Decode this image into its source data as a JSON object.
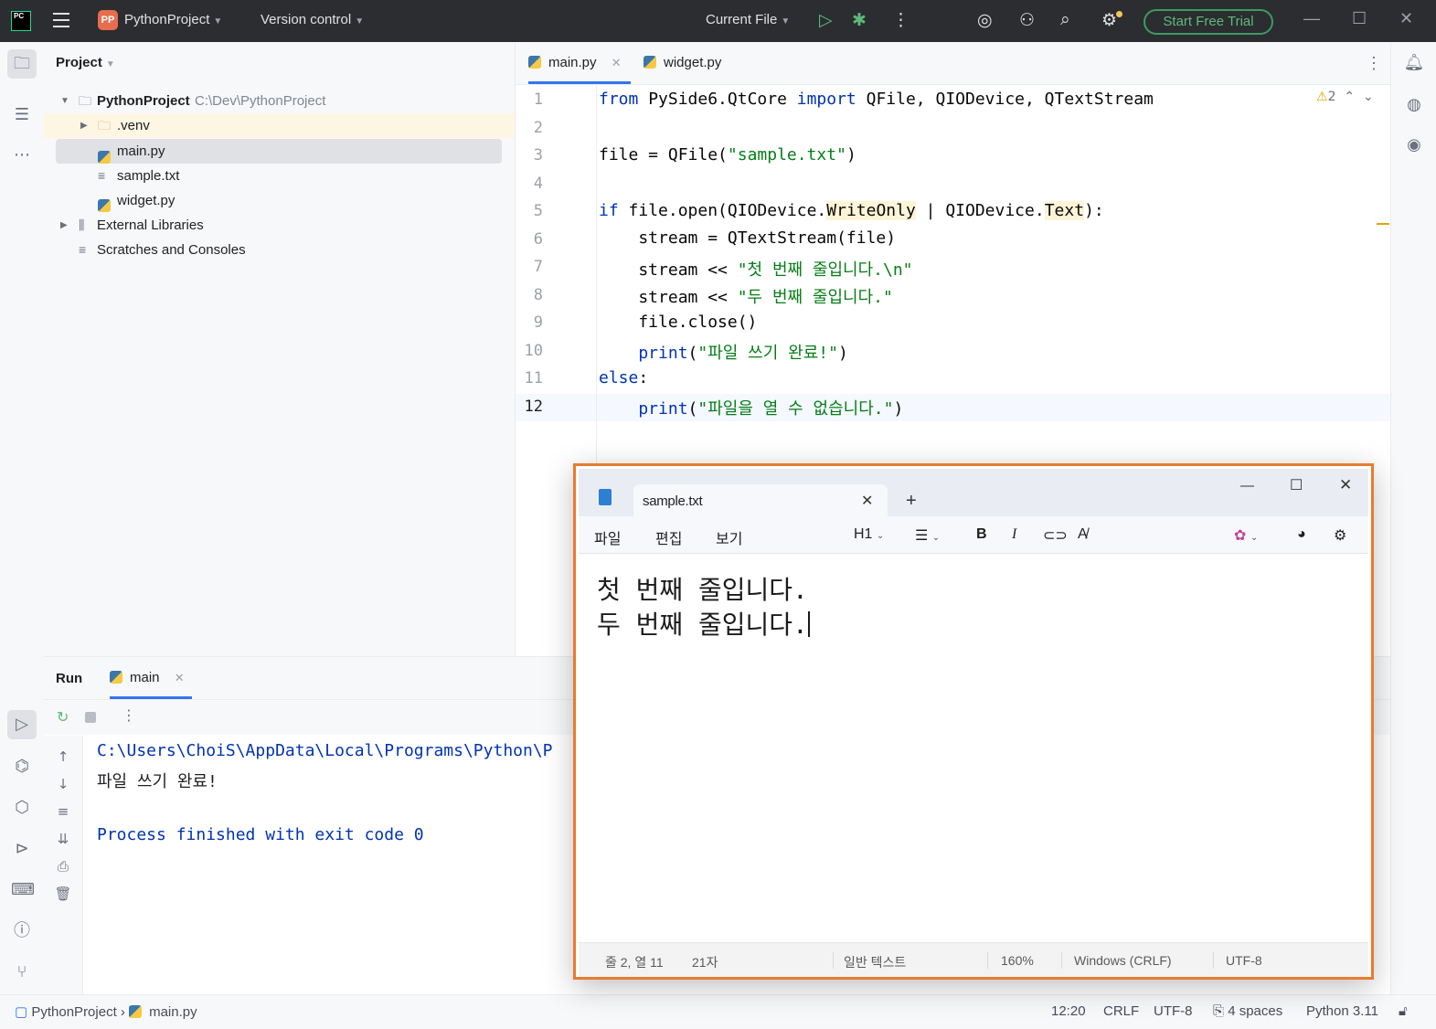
{
  "titlebar": {
    "project_badge": "PP",
    "project_name": "PythonProject",
    "vcs": "Version control",
    "run_config": "Current File",
    "trial_button": "Start Free Trial"
  },
  "project_panel": {
    "header": "Project",
    "root_name": "PythonProject",
    "root_path": "C:\\Dev\\PythonProject",
    "items": [
      {
        "label": ".venv"
      },
      {
        "label": "main.py"
      },
      {
        "label": "sample.txt"
      },
      {
        "label": "widget.py"
      },
      {
        "label": "External Libraries"
      },
      {
        "label": "Scratches and Consoles"
      }
    ]
  },
  "editor": {
    "tabs": [
      {
        "label": "main.py",
        "active": true
      },
      {
        "label": "widget.py",
        "active": false
      }
    ],
    "warning_count": "2",
    "line_numbers": [
      "1",
      "2",
      "3",
      "4",
      "5",
      "6",
      "7",
      "8",
      "9",
      "10",
      "11",
      "12"
    ],
    "lines": {
      "l1_kw1": "from",
      "l1_mod": " PySide6.QtCore ",
      "l1_kw2": "import",
      "l1_rest": " QFile, QIODevice, QTextStream",
      "l3_a": "file = QFile(",
      "l3_str": "\"sample.txt\"",
      "l3_b": ")",
      "l5_kw": "if",
      "l5_a": " file.open(QIODevice.",
      "l5_wo": "WriteOnly",
      "l5_b": " | QIODevice.",
      "l5_text": "Text",
      "l5_c": "):",
      "l6": "    stream = QTextStream(file)",
      "l7_a": "    stream << ",
      "l7_str": "\"첫 번째 줄입니다.\\n\"",
      "l8_a": "    stream << ",
      "l8_str": "\"두 번째 줄입니다.\"",
      "l9": "    file.close()",
      "l10_fn": "    print",
      "l10_a": "(",
      "l10_str": "\"파일 쓰기 완료!\"",
      "l10_b": ")",
      "l11_kw": "else",
      "l11_a": ":",
      "l12_fn": "    print",
      "l12_a": "(",
      "l12_str": "\"파일을 열 수 없습니다.\"",
      "l12_b": ")"
    }
  },
  "run_panel": {
    "title": "Run",
    "tab": "main",
    "output": [
      "C:\\Users\\ChoiS\\AppData\\Local\\Programs\\Python\\P",
      "파일 쓰기 완료!",
      "",
      "Process finished with exit code 0"
    ]
  },
  "statusbar": {
    "project": "PythonProject",
    "file": "main.py",
    "position": "12:20",
    "line_sep": "CRLF",
    "encoding": "UTF-8",
    "indent": "4 spaces",
    "interpreter": "Python 3.11"
  },
  "notepad": {
    "tab_title": "sample.txt",
    "menu": [
      "파일",
      "편집",
      "보기"
    ],
    "heading": "H1",
    "content": [
      "첫 번째 줄입니다.",
      "두 번째 줄입니다."
    ],
    "status": {
      "cursor": "줄 2, 열 11",
      "chars": "21자",
      "format": "일반 텍스트",
      "zoom": "160%",
      "line_ending": "Windows (CRLF)",
      "encoding": "UTF-8"
    }
  },
  "colors": {
    "keyword": "#0033b3",
    "string": "#067d17",
    "accent": "#3574f0",
    "highlight_border": "#e87c2e",
    "trial": "#5fb97b"
  }
}
